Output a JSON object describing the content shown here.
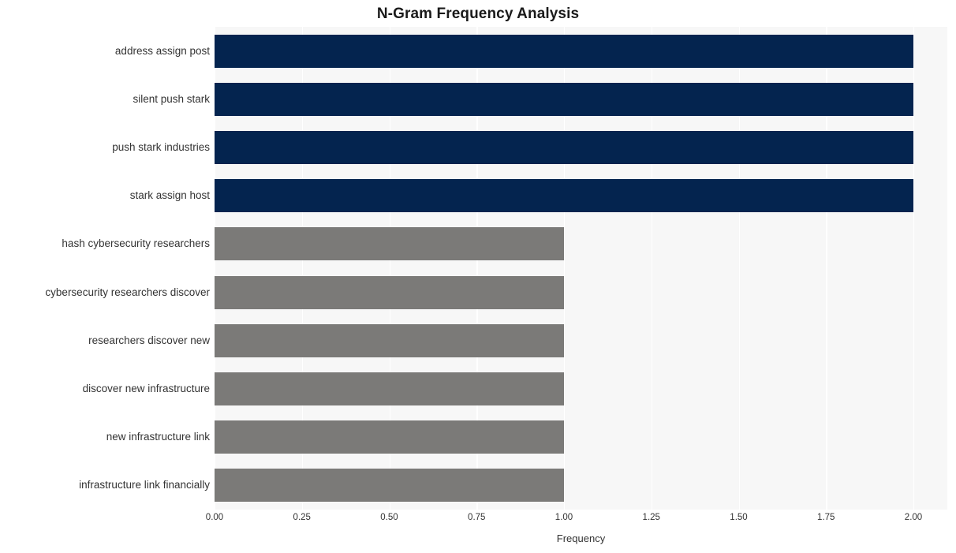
{
  "chart_data": {
    "type": "bar",
    "orientation": "horizontal",
    "title": "N-Gram Frequency Analysis",
    "xlabel": "Frequency",
    "ylabel": "",
    "xlim": [
      0,
      2.0
    ],
    "xticks": [
      "0.00",
      "0.25",
      "0.50",
      "0.75",
      "1.00",
      "1.25",
      "1.50",
      "1.75",
      "2.00"
    ],
    "xtick_values": [
      0,
      0.25,
      0.5,
      0.75,
      1.0,
      1.25,
      1.5,
      1.75,
      2.0
    ],
    "grid": true,
    "grid_axis": "x",
    "legend": "none",
    "categories": [
      "address assign post",
      "silent push stark",
      "push stark industries",
      "stark assign host",
      "hash cybersecurity researchers",
      "cybersecurity researchers discover",
      "researchers discover new",
      "discover new infrastructure",
      "new infrastructure link",
      "infrastructure link financially"
    ],
    "values": [
      2,
      2,
      2,
      2,
      1,
      1,
      1,
      1,
      1,
      1
    ],
    "bar_colors": [
      "#04244f",
      "#04244f",
      "#04244f",
      "#04244f",
      "#7b7a78",
      "#7b7a78",
      "#7b7a78",
      "#7b7a78",
      "#7b7a78",
      "#7b7a78"
    ],
    "palette": {
      "high_frequency": "#04244f",
      "low_frequency": "#7b7a78",
      "plot_background": "#f7f7f7",
      "gridline": "#ffffff",
      "figure_background": "#ffffff",
      "text": "#333333",
      "title_text": "#1a1a1a"
    }
  }
}
